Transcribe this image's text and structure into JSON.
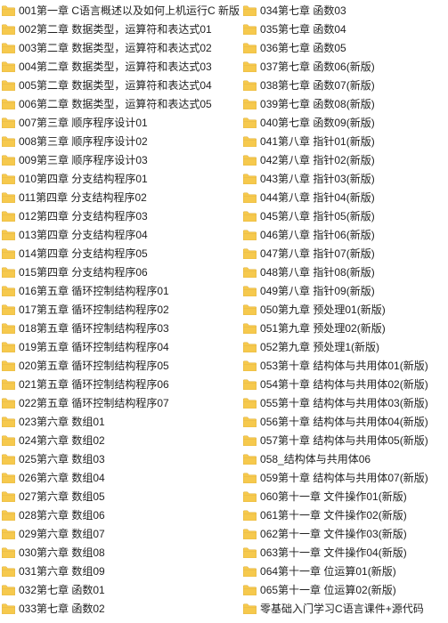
{
  "left": [
    "001第一章 C语言概述以及如何上机运行C 新版",
    "002第二章 数据类型，运算符和表达式01",
    "003第二章 数据类型，运算符和表达式02",
    "004第二章 数据类型，运算符和表达式03",
    "005第二章 数据类型，运算符和表达式04",
    "006第二章 数据类型，运算符和表达式05",
    "007第三章 顺序程序设计01",
    "008第三章 顺序程序设计02",
    "009第三章 顺序程序设计03",
    "010第四章 分支结构程序01",
    "011第四章 分支结构程序02",
    "012第四章 分支结构程序03",
    "013第四章 分支结构程序04",
    "014第四章 分支结构程序05",
    "015第四章 分支结构程序06",
    "016第五章 循环控制结构程序01",
    "017第五章 循环控制结构程序02",
    "018第五章 循环控制结构程序03",
    "019第五章 循环控制结构程序04",
    "020第五章 循环控制结构程序05",
    "021第五章 循环控制结构程序06",
    "022第五章 循环控制结构程序07",
    "023第六章 数组01",
    "024第六章 数组02",
    "025第六章 数组03",
    "026第六章 数组04",
    "027第六章 数组05",
    "028第六章 数组06",
    "029第六章 数组07",
    "030第六章 数组08",
    "031第六章 数组09",
    "032第七章 函数01",
    "033第七章 函数02"
  ],
  "right": [
    "034第七章 函数03",
    "035第七章 函数04",
    "036第七章 函数05",
    "037第七章 函数06(新版)",
    "038第七章 函数07(新版)",
    "039第七章 函数08(新版)",
    "040第七章 函数09(新版)",
    "041第八章 指针01(新版)",
    "042第八章 指针02(新版)",
    "043第八章 指针03(新版)",
    "044第八章 指针04(新版)",
    "045第八章 指针05(新版)",
    "046第八章 指针06(新版)",
    "047第八章 指针07(新版)",
    "048第八章 指针08(新版)",
    "049第八章 指针09(新版)",
    "050第九章 预处理01(新版)",
    "051第九章 预处理02(新版)",
    "052第九章 预处理1(新版)",
    "053第十章 结构体与共用体01(新版)",
    "054第十章 结构体与共用体02(新版)",
    "055第十章 结构体与共用体03(新版)",
    "056第十章 结构体与共用体04(新版)",
    "057第十章 结构体与共用体05(新版)",
    "058_结构体与共用体06",
    "059第十章 结构体与共用体07(新版)",
    "060第十一章 文件操作01(新版)",
    "061第十一章 文件操作02(新版)",
    "062第十一章 文件操作03(新版)",
    "063第十一章 文件操作04(新版)",
    "064第十一章 位运算01(新版)",
    "065第十一章 位运算02(新版)",
    "零基础入门学习C语言课件+源代码"
  ]
}
